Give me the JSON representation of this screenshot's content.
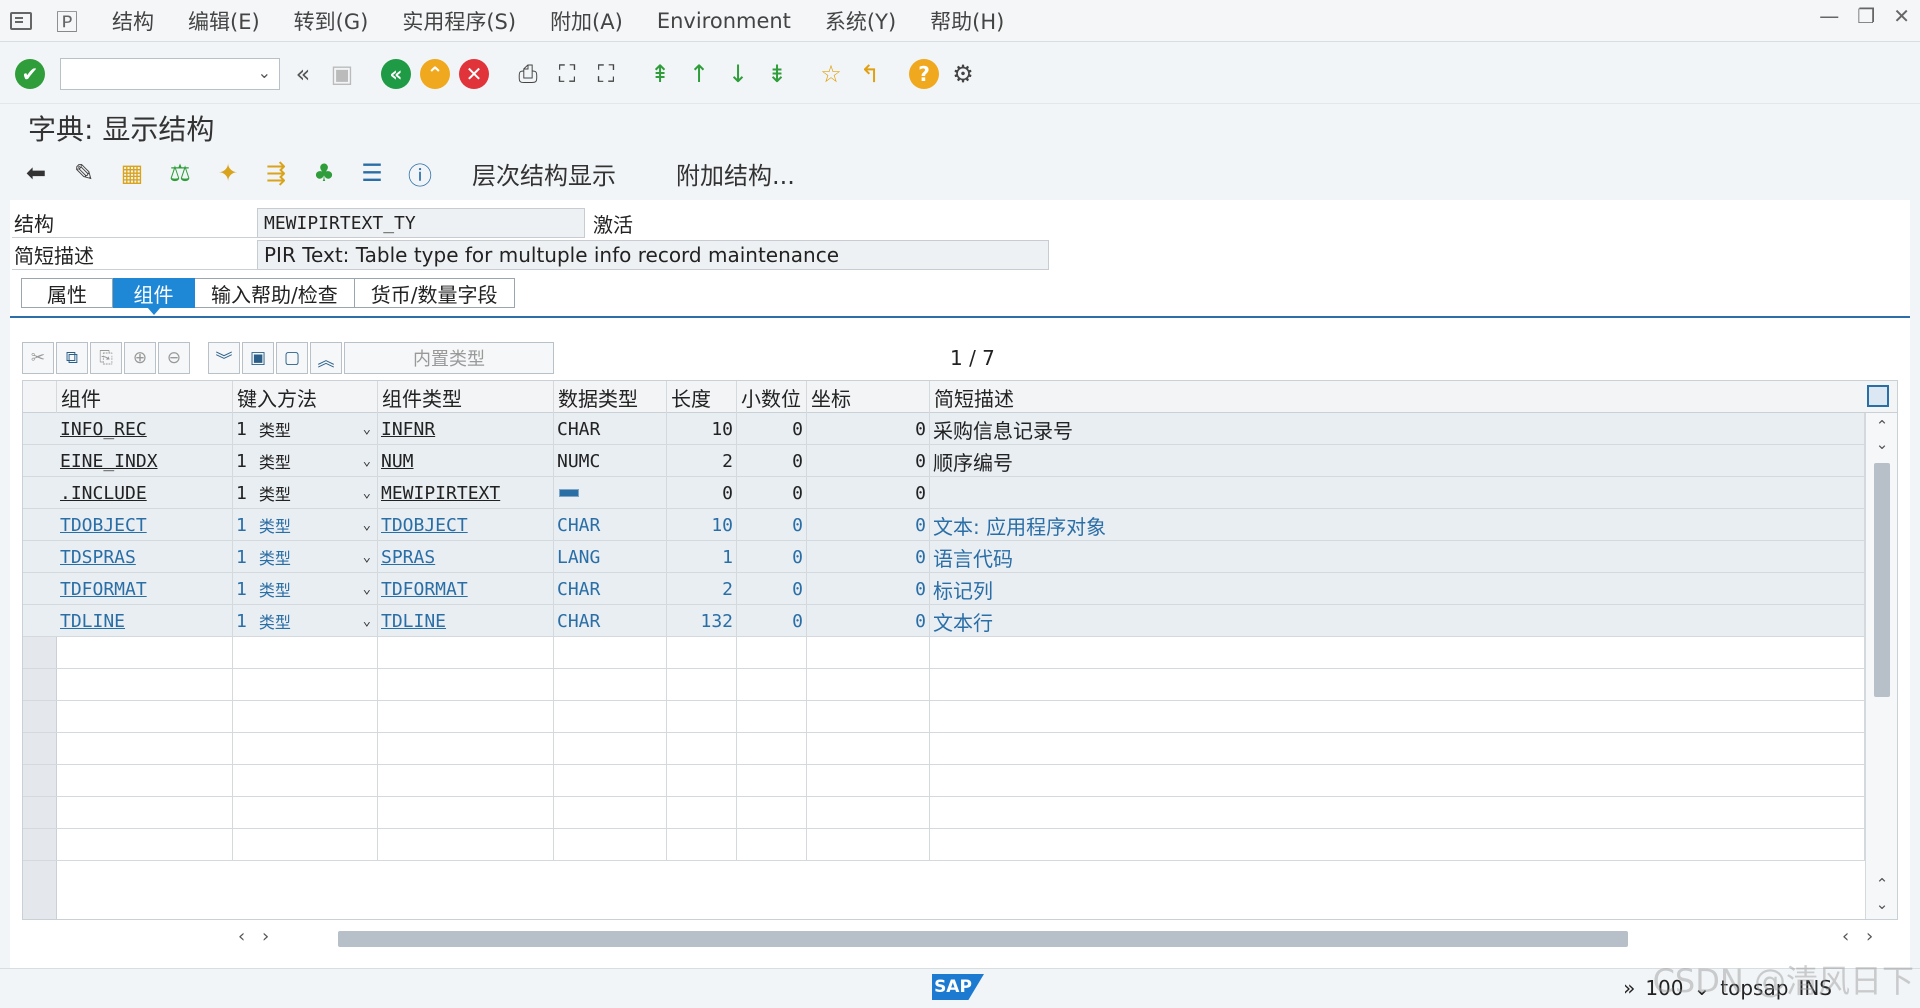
{
  "menu": {
    "items": [
      "结构",
      "编辑(E)",
      "转到(G)",
      "实用程序(S)",
      "附加(A)",
      "Environment",
      "系统(Y)",
      "帮助(H)"
    ]
  },
  "toolbar": {
    "command_value": "",
    "icons": [
      "enter-icon",
      "back-double-icon",
      "save-icon",
      "back-icon",
      "exit-icon",
      "cancel-icon",
      "print-icon",
      "find-icon",
      "find-next-icon",
      "first-page-icon",
      "prev-page-icon",
      "next-page-icon",
      "last-page-icon",
      "create-session-icon",
      "shortcut-icon",
      "help-icon",
      "settings-icon"
    ]
  },
  "title": "字典: 显示结构",
  "app_toolbar": {
    "hierarchy_label": "层次结构显示",
    "append_label": "附加结构..."
  },
  "form": {
    "structure_label": "结构",
    "structure_value": "MEWIPIRTEXT_TY",
    "structure_status": "激活",
    "desc_label": "简短描述",
    "desc_value": "PIR Text: Table type for multuple info record maintenance"
  },
  "tabs": [
    "属性",
    "组件",
    "输入帮助/检查",
    "货币/数量字段"
  ],
  "active_tab": 1,
  "grid_toolbar": {
    "builtin_type_label": "内置类型",
    "pager": "1 / 7"
  },
  "grid": {
    "headers": [
      "组件",
      "键入方法",
      "组件类型",
      "数据类型",
      "长度",
      "小数位",
      "坐标",
      "简短描述"
    ],
    "rows": [
      {
        "comp": "INFO_REC",
        "m": "1",
        "typ": "类型",
        "ctype": "INFNR",
        "dtype": "CHAR",
        "len": "10",
        "dec": "0",
        "coord": "0",
        "desc": "采购信息记录号",
        "style": "black"
      },
      {
        "comp": "EINE_INDX",
        "m": "1",
        "typ": "类型",
        "ctype": "NUM",
        "dtype": "NUMC",
        "len": "2",
        "dec": "0",
        "coord": "0",
        "desc": "顺序编号",
        "style": "black"
      },
      {
        "comp": ".INCLUDE",
        "m": "1",
        "typ": "类型",
        "ctype": "MEWIPIRTEXT",
        "dtype": "",
        "len": "0",
        "dec": "0",
        "coord": "0",
        "desc": "",
        "style": "black"
      },
      {
        "comp": "TDOBJECT",
        "m": "1",
        "typ": "类型",
        "ctype": "TDOBJECT",
        "dtype": "CHAR",
        "len": "10",
        "dec": "0",
        "coord": "0",
        "desc": "文本: 应用程序对象",
        "style": "blue"
      },
      {
        "comp": "TDSPRAS",
        "m": "1",
        "typ": "类型",
        "ctype": "SPRAS",
        "dtype": "LANG",
        "len": "1",
        "dec": "0",
        "coord": "0",
        "desc": "语言代码",
        "style": "blue"
      },
      {
        "comp": "TDFORMAT",
        "m": "1",
        "typ": "类型",
        "ctype": "TDFORMAT",
        "dtype": "CHAR",
        "len": "2",
        "dec": "0",
        "coord": "0",
        "desc": "标记列",
        "style": "blue"
      },
      {
        "comp": "TDLINE",
        "m": "1",
        "typ": "类型",
        "ctype": "TDLINE",
        "dtype": "CHAR",
        "len": "132",
        "dec": "0",
        "coord": "0",
        "desc": "文本行",
        "style": "blue"
      }
    ]
  },
  "status": {
    "zoom": "100",
    "system": "topsap",
    "mode": "INS",
    "logo": "SAP"
  },
  "watermark": "CSDN @清风日下",
  "colors": {
    "accent": "#1e88d6",
    "link": "#2a6ea6"
  }
}
